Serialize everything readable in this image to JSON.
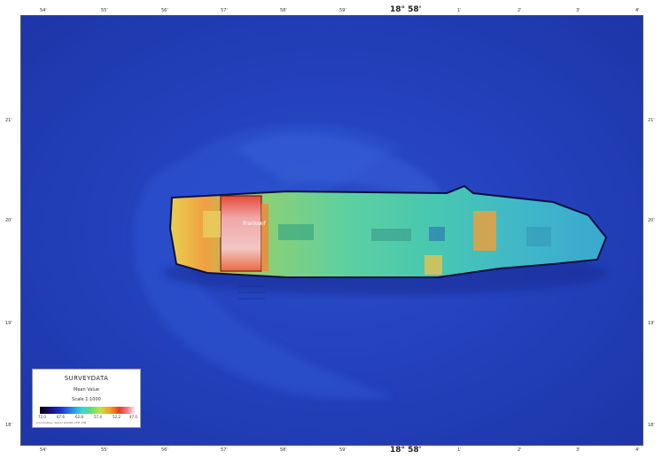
{
  "map": {
    "center_label_top": "18° 58'",
    "center_label_bottom": "18° 58'",
    "top_ticks": [
      "54'",
      "55'",
      "56'",
      "57'",
      "58'",
      "59'",
      "1'",
      "2'",
      "3'",
      "4'"
    ],
    "bottom_ticks": [
      "54'",
      "55'",
      "56'",
      "57'",
      "58'",
      "59'",
      "1'",
      "2'",
      "3'",
      "4'"
    ],
    "left_ticks": [
      "21'",
      "20'",
      "19'",
      "18'"
    ],
    "right_ticks": [
      "21'",
      "20'",
      "19'",
      "18'"
    ],
    "wreck_label": "Frankenf"
  },
  "legend": {
    "title": "SURVEYDATA",
    "subtitle": "Mean Value",
    "scale": "Scale 1:1000",
    "colorbar_labels": [
      "72.0",
      "67.6",
      "62.8",
      "57.4",
      "52.2",
      "47.0"
    ],
    "fine_print": "Coordinates: datum WGS84 UTM 33N"
  },
  "colors": {
    "seafloor": "#2442bd",
    "hull_main": "#4cc4a0",
    "hot": "#e8463a"
  }
}
